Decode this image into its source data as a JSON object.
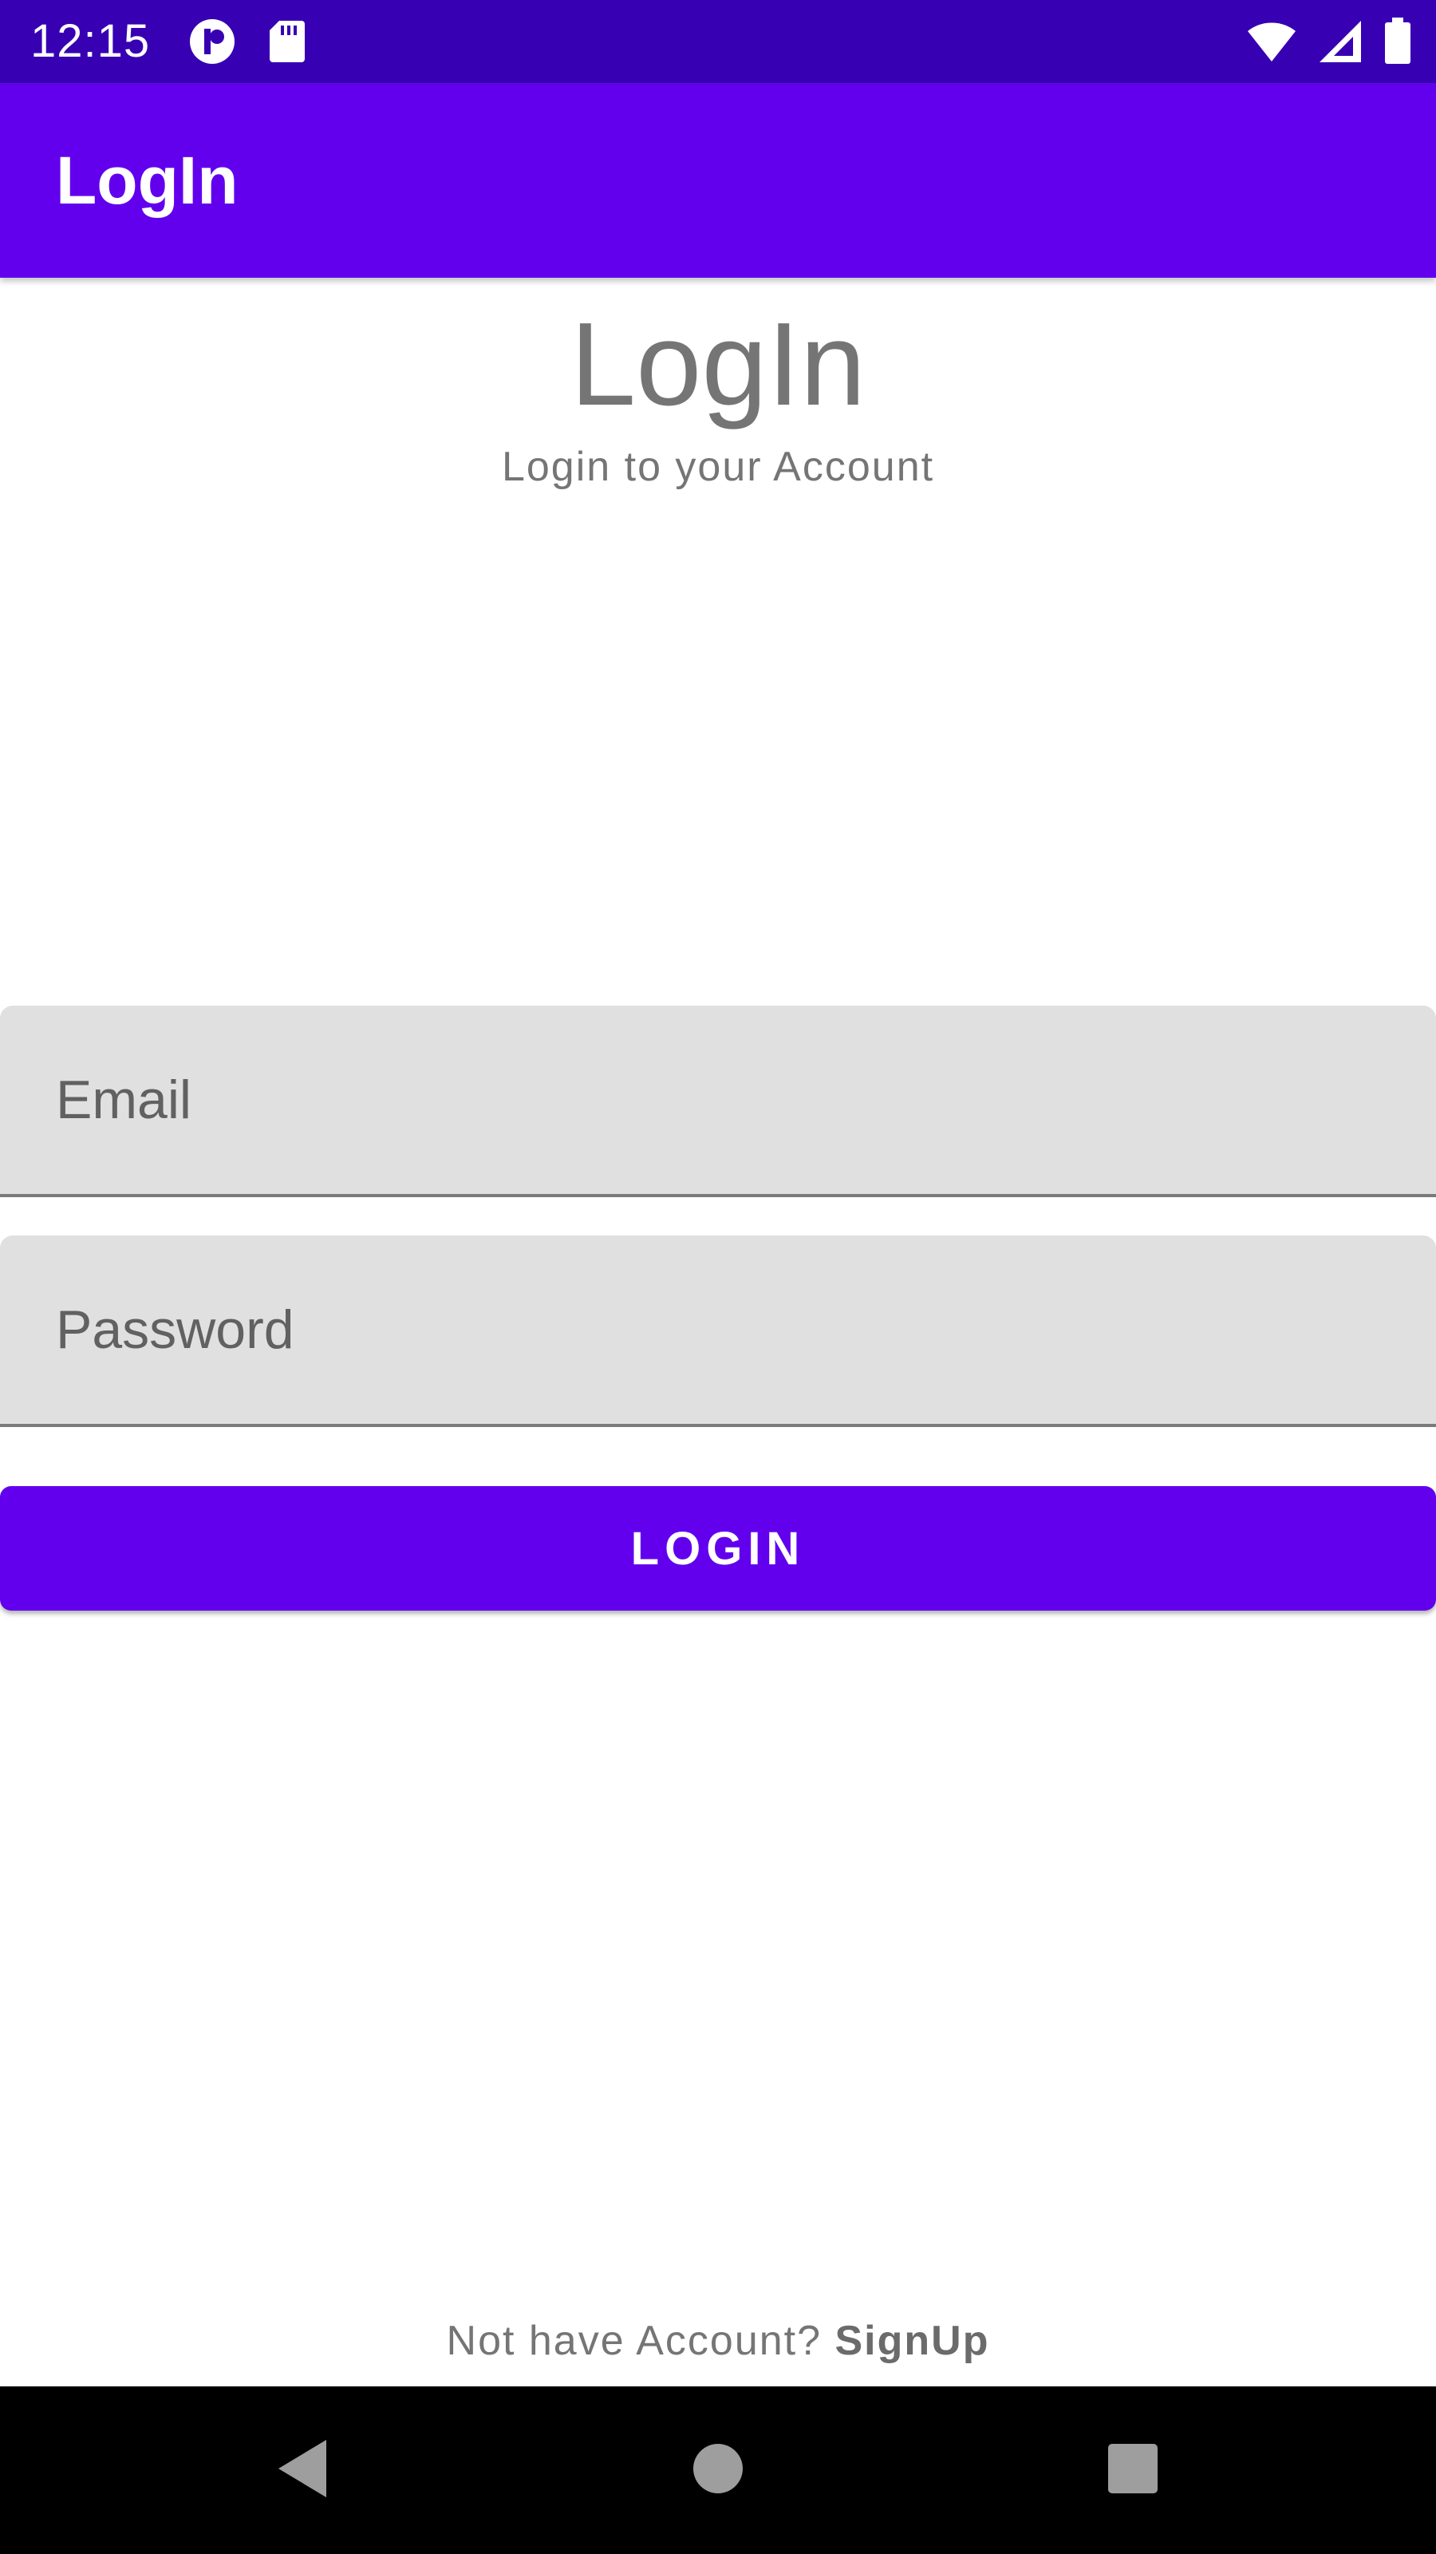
{
  "status_bar": {
    "time": "12:15",
    "left_icons": [
      "app-notification-icon",
      "sd-card-icon"
    ],
    "right_icons": [
      "wifi-icon",
      "signal-icon",
      "battery-icon"
    ],
    "background": "#3700b3"
  },
  "app_bar": {
    "title": "LogIn",
    "background": "#6200ee"
  },
  "header": {
    "title": "LogIn",
    "subtitle": "Login to your Account"
  },
  "form": {
    "email_placeholder": "Email",
    "email_value": "",
    "password_placeholder": "Password",
    "password_value": "",
    "login_label": "LOGIN",
    "accent": "#6200ee"
  },
  "footer": {
    "prompt": "Not have Account? ",
    "signup_label": "SignUp"
  },
  "nav_bar": {
    "icons": [
      "back-icon",
      "home-icon",
      "recents-icon"
    ]
  }
}
